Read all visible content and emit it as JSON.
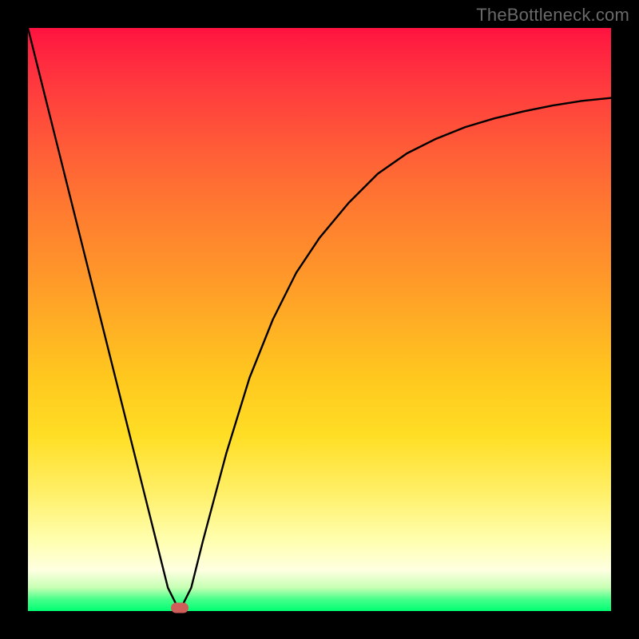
{
  "watermark": "TheBottleneck.com",
  "colors": {
    "frame": "#000000",
    "curve": "#000000",
    "marker": "#cf5d5a",
    "watermark": "#6a6a6a"
  },
  "chart_data": {
    "type": "line",
    "title": "",
    "xlabel": "",
    "ylabel": "",
    "xlim": [
      0,
      100
    ],
    "ylim": [
      0,
      100
    ],
    "grid": false,
    "legend": false,
    "series": [
      {
        "name": "curve",
        "x": [
          0,
          5,
          10,
          15,
          20,
          24,
          26,
          28,
          30,
          34,
          38,
          42,
          46,
          50,
          55,
          60,
          65,
          70,
          75,
          80,
          85,
          90,
          95,
          100
        ],
        "y": [
          100,
          80,
          60,
          40,
          20,
          4,
          0,
          4,
          12,
          27,
          40,
          50,
          58,
          64,
          70,
          75,
          78.5,
          81,
          83,
          84.5,
          85.7,
          86.7,
          87.5,
          88
        ]
      }
    ],
    "annotations": [
      {
        "name": "min-marker",
        "x": 26,
        "y": 0
      }
    ],
    "gradient_stops": [
      {
        "pos": 0,
        "color": "#ff1240"
      },
      {
        "pos": 50,
        "color": "#ffb224"
      },
      {
        "pos": 88,
        "color": "#ffffb0"
      },
      {
        "pos": 100,
        "color": "#00ff73"
      }
    ]
  }
}
